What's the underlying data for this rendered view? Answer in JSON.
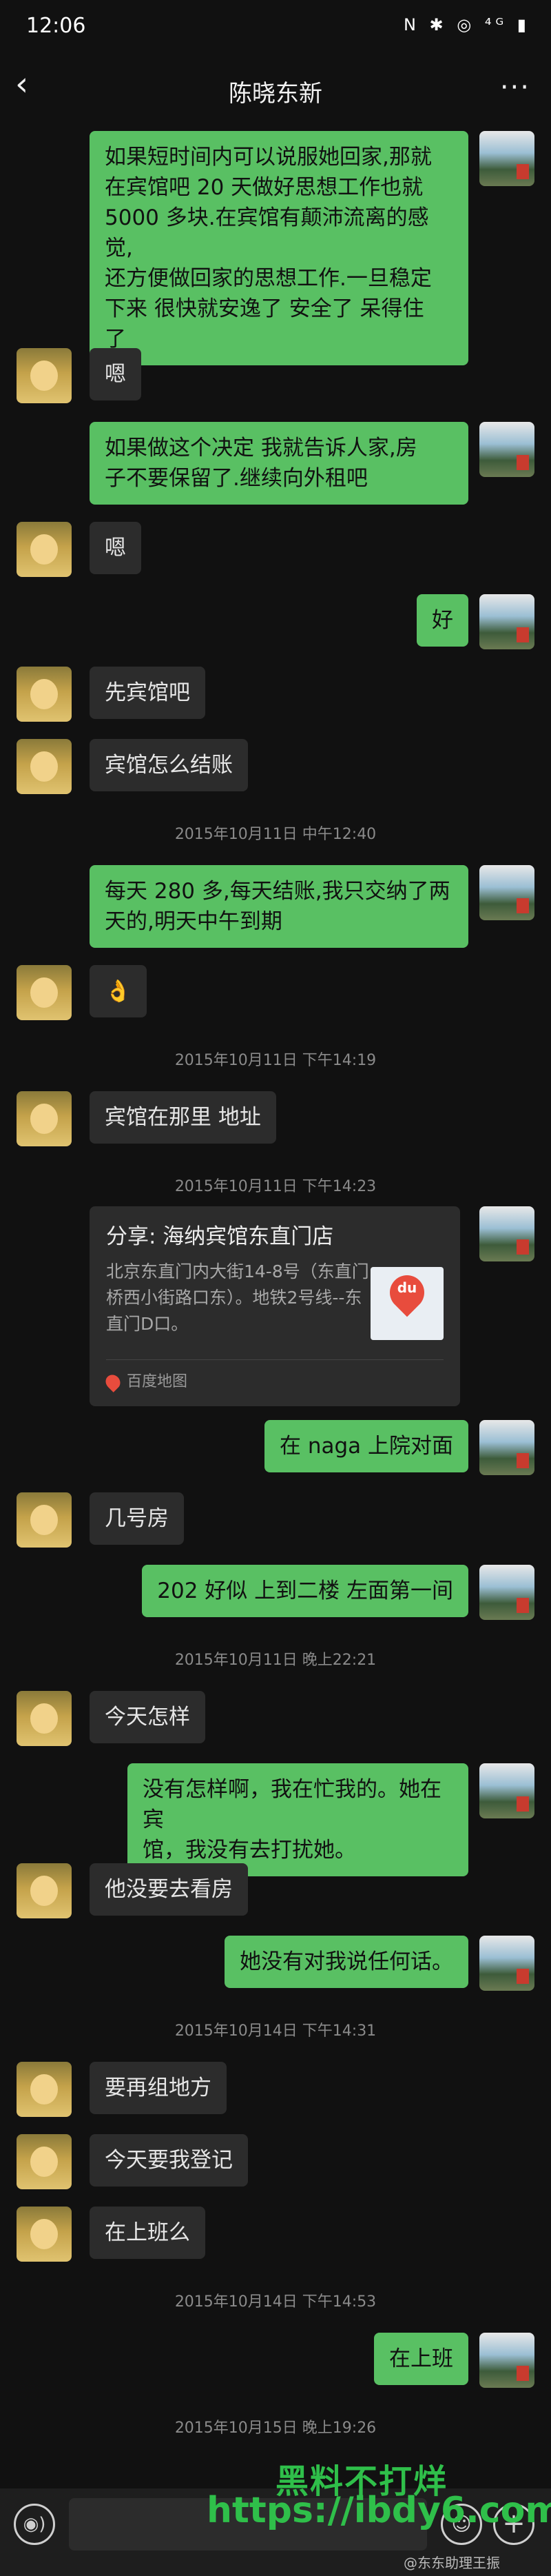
{
  "status_bar": {
    "time": "12:06",
    "icons": "N ✱ ◎ ⁴ᴳ ▮"
  },
  "header": {
    "back_glyph": "‹",
    "title": "陈晓东新",
    "more_glyph": "···"
  },
  "messages": [
    {
      "side": "right",
      "text": "如果短时间内可以说服她回家,那就\n在宾馆吧  20 天做好思想工作也就\n5000 多块.在宾馆有颠沛流离的感觉,\n还方便做回家的思想工作.一旦稳定\n下来  很快就安逸了  安全了  呆得住\n了"
    },
    {
      "side": "left",
      "text": "嗯"
    },
    {
      "side": "right",
      "text": "如果做这个决定  我就告诉人家,房\n子不要保留了.继续向外租吧"
    },
    {
      "side": "left",
      "text": "嗯"
    },
    {
      "side": "right",
      "text": "好"
    },
    {
      "side": "left",
      "text": "先宾馆吧"
    },
    {
      "side": "left",
      "text": "宾馆怎么结账"
    },
    {
      "side": "time",
      "text": "2015年10月11日  中午12:40"
    },
    {
      "side": "right",
      "text": "每天 280 多,每天结账,我只交纳了两\n天的,明天中午到期"
    },
    {
      "side": "left",
      "text": "👌"
    },
    {
      "side": "time",
      "text": "2015年10月11日  下午14:19"
    },
    {
      "side": "left",
      "text": "宾馆在那里  地址"
    },
    {
      "side": "time",
      "text": "2015年10月11日  下午14:23"
    },
    {
      "side": "right",
      "text": "在 naga 上院对面"
    },
    {
      "side": "left",
      "text": "几号房"
    },
    {
      "side": "right",
      "text": "202  好似  上到二楼  左面第一间"
    },
    {
      "side": "time",
      "text": "2015年10月11日  晚上22:21"
    },
    {
      "side": "left",
      "text": "今天怎样"
    },
    {
      "side": "right",
      "text": "没有怎样啊，我在忙我的。她在宾\n馆，我没有去打扰她。"
    },
    {
      "side": "left",
      "text": "他没要去看房"
    },
    {
      "side": "right",
      "text": "她没有对我说任何话。"
    },
    {
      "side": "time",
      "text": "2015年10月14日  下午14:31"
    },
    {
      "side": "left",
      "text": "要再组地方"
    },
    {
      "side": "left",
      "text": "今天要我登记"
    },
    {
      "side": "left",
      "text": "在上班么"
    },
    {
      "side": "time",
      "text": "2015年10月14日  下午14:53"
    },
    {
      "side": "right",
      "text": "在上班"
    },
    {
      "side": "time",
      "text": "2015年10月15日  晚上19:26"
    }
  ],
  "share_card": {
    "title": "分享:  海纳宾馆东直门店",
    "description": "北京东直门内大街14-8号（东直门桥西小街路口东）。地铁2号线--东直门D口。",
    "thumb_label": "du",
    "source": "百度地图"
  },
  "input_bar": {
    "voice_glyph": "◉)",
    "emoji_glyph": "☺",
    "plus_glyph": "+"
  },
  "watermark": {
    "line1": "黑料不打烊",
    "line2": "https://ibdy6.com",
    "line3": "@东东助理王振"
  },
  "colors": {
    "background": "#111111",
    "bubble_left": "#2c2c2c",
    "bubble_right": "#59c063",
    "watermark": "#2fbf4a"
  }
}
